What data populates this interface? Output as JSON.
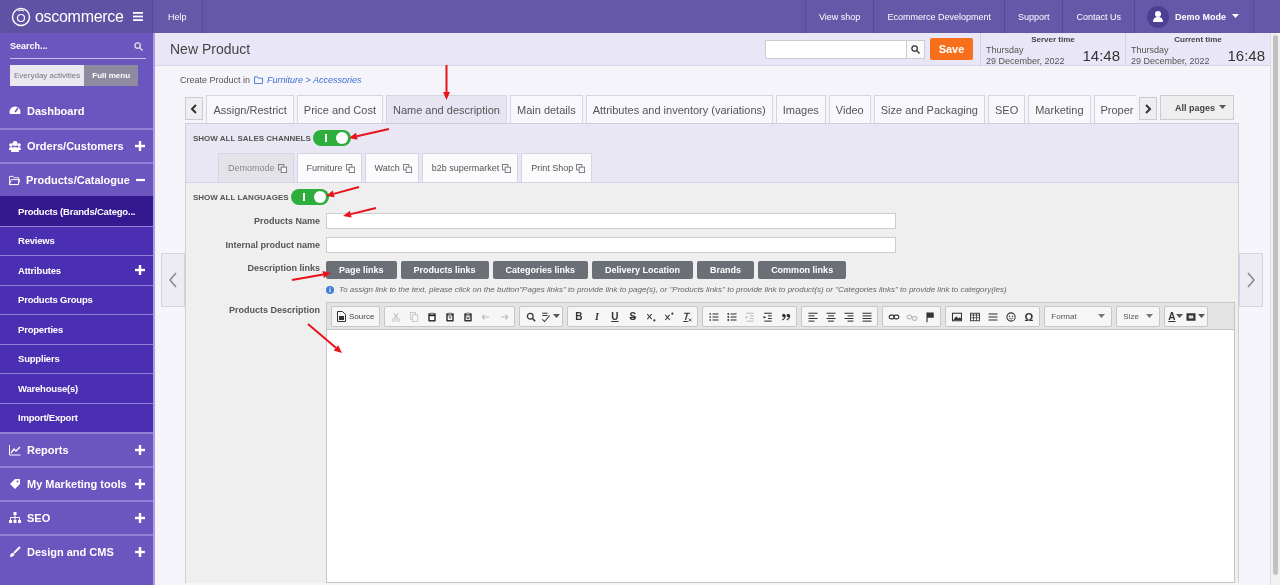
{
  "top_bar": {
    "logo": "oscommerce",
    "help_link": "Help",
    "links": [
      "View shop",
      "Ecommerce Development",
      "Support",
      "Contact Us"
    ],
    "user": "Demo Mode"
  },
  "sidebar": {
    "search": {
      "placeholder": "Search..."
    },
    "menu_tabs": [
      {
        "label": "Everyday activities",
        "selected": false
      },
      {
        "label": "Full menu",
        "selected": true
      }
    ],
    "items": [
      {
        "label": "Dashboard",
        "kind": "link"
      },
      {
        "label": "Orders/Customers",
        "kind": "collapsed"
      },
      {
        "label": "Products/Catalogue",
        "kind": "expanded",
        "children": [
          {
            "label": "Products (Brands/Catego...",
            "selected": true,
            "kind": "link"
          },
          {
            "label": "Reviews",
            "selected": false,
            "kind": "link"
          },
          {
            "label": "Attributes",
            "selected": false,
            "kind": "collapsed"
          },
          {
            "label": "Products Groups",
            "selected": false,
            "kind": "link"
          },
          {
            "label": "Properties",
            "selected": false,
            "kind": "link"
          },
          {
            "label": "Suppliers",
            "selected": false,
            "kind": "link"
          },
          {
            "label": "Warehouse(s)",
            "selected": false,
            "kind": "link"
          },
          {
            "label": "Import/Export",
            "selected": false,
            "kind": "link"
          }
        ]
      },
      {
        "label": "Reports",
        "kind": "collapsed"
      },
      {
        "label": "My Marketing tools",
        "kind": "collapsed"
      },
      {
        "label": "SEO",
        "kind": "collapsed"
      },
      {
        "label": "Design and CMS",
        "kind": "collapsed"
      }
    ]
  },
  "header": {
    "title": "New Product",
    "save_button": "Save",
    "server_time": {
      "label": "Server time",
      "day": "Thursday",
      "date": "29 December, 2022",
      "time": "14:48"
    },
    "current_time": {
      "label": "Current time",
      "day": "Thursday",
      "date": "29 December, 2022",
      "time": "16:48"
    }
  },
  "breadcrumb": {
    "prefix": "Create Product in",
    "path": "Furniture > Accessories"
  },
  "tabs": [
    {
      "label": "Assign/Restrict",
      "selected": false,
      "annotated": false
    },
    {
      "label": "Price and Cost",
      "selected": false,
      "annotated": false
    },
    {
      "label": "Name and description",
      "selected": true,
      "annotated": true
    },
    {
      "label": "Main details",
      "selected": false,
      "annotated": false
    },
    {
      "label": "Attributes and inventory (variations)",
      "selected": false,
      "annotated": false
    },
    {
      "label": "Images",
      "selected": false,
      "annotated": false
    },
    {
      "label": "Video",
      "selected": false,
      "annotated": false
    },
    {
      "label": "Size and Packaging",
      "selected": false,
      "annotated": false
    },
    {
      "label": "SEO",
      "selected": false,
      "annotated": false
    },
    {
      "label": "Marketing",
      "selected": false,
      "annotated": false
    },
    {
      "label": "Proper",
      "selected": false,
      "annotated": false
    }
  ],
  "pages_dropdown": "All pages",
  "sales_channels": {
    "label": "SHOW ALL SALES CHANNELS",
    "on": true,
    "annotated": true,
    "channels": [
      {
        "label": "Demomode",
        "selected": true
      },
      {
        "label": "Furniture",
        "selected": false
      },
      {
        "label": "Watch",
        "selected": false
      },
      {
        "label": "b2b supermarket",
        "selected": false
      },
      {
        "label": "Print Shop",
        "selected": false
      }
    ]
  },
  "languages": {
    "label": "SHOW ALL LANGUAGES",
    "on": true,
    "annotated": true
  },
  "fields": [
    {
      "label": "Products Name",
      "annotated": true
    },
    {
      "label": "Internal product name",
      "annotated": false
    }
  ],
  "description_links": {
    "label": "Description links",
    "buttons": [
      {
        "label": "Page links",
        "annotated": true
      },
      {
        "label": "Products links",
        "annotated": false
      },
      {
        "label": "Categories links",
        "annotated": false
      },
      {
        "label": "Delivery Location",
        "annotated": false
      },
      {
        "label": "Brands",
        "annotated": false
      },
      {
        "label": "Common links",
        "annotated": false
      }
    ],
    "note": "To assign link to the text, please click on the button\"Pages links\" to provide link to page(s), or \"Products links\" to provide link to product(s) or \"Categories links\" to provide link to category(ies)"
  },
  "description_editor": {
    "label": "Products Description",
    "annotated": true,
    "toolbar": [
      [
        {
          "kind": "button",
          "label": "Source",
          "disabled": false
        }
      ],
      [
        {
          "kind": "icon",
          "disabled": true
        },
        {
          "kind": "icon",
          "disabled": true
        },
        {
          "kind": "icon",
          "disabled": false
        },
        {
          "kind": "icon",
          "disabled": false
        },
        {
          "kind": "icon",
          "disabled": false
        },
        {
          "kind": "icon",
          "disabled": true
        },
        {
          "kind": "icon",
          "disabled": true
        }
      ],
      [
        {
          "kind": "icon",
          "disabled": false
        },
        {
          "kind": "icon-menu",
          "disabled": false
        }
      ],
      [
        {
          "kind": "bold",
          "label": "B",
          "disabled": false
        },
        {
          "kind": "italic",
          "label": "I",
          "disabled": false
        },
        {
          "kind": "underline",
          "label": "U",
          "disabled": false
        },
        {
          "kind": "strike",
          "label": "S",
          "disabled": false
        },
        {
          "kind": "icon",
          "disabled": false
        },
        {
          "kind": "icon",
          "disabled": false
        },
        {
          "kind": "icon",
          "disabled": false
        }
      ],
      [
        {
          "kind": "icon",
          "disabled": false
        },
        {
          "kind": "icon",
          "disabled": false
        },
        {
          "kind": "icon",
          "disabled": true
        },
        {
          "kind": "icon",
          "disabled": false
        },
        {
          "kind": "icon",
          "disabled": false
        }
      ],
      [
        {
          "kind": "icon",
          "disabled": false
        },
        {
          "kind": "icon",
          "disabled": false
        },
        {
          "kind": "icon",
          "disabled": false
        },
        {
          "kind": "icon",
          "disabled": false
        }
      ],
      [
        {
          "kind": "icon",
          "disabled": false
        },
        {
          "kind": "icon",
          "disabled": true
        },
        {
          "kind": "icon",
          "disabled": false
        }
      ],
      [
        {
          "kind": "icon",
          "disabled": false
        },
        {
          "kind": "icon",
          "disabled": false
        },
        {
          "kind": "icon",
          "disabled": false
        },
        {
          "kind": "icon",
          "disabled": false
        },
        {
          "kind": "glyph",
          "label": "Ω",
          "disabled": false
        }
      ],
      [
        {
          "kind": "combo",
          "label": "Format",
          "disabled": false
        }
      ],
      [
        {
          "kind": "combo",
          "label": "Size",
          "disabled": false
        }
      ],
      [
        {
          "kind": "color-menu",
          "label": "A",
          "disabled": false
        },
        {
          "kind": "icon-menu",
          "disabled": false
        }
      ]
    ]
  }
}
